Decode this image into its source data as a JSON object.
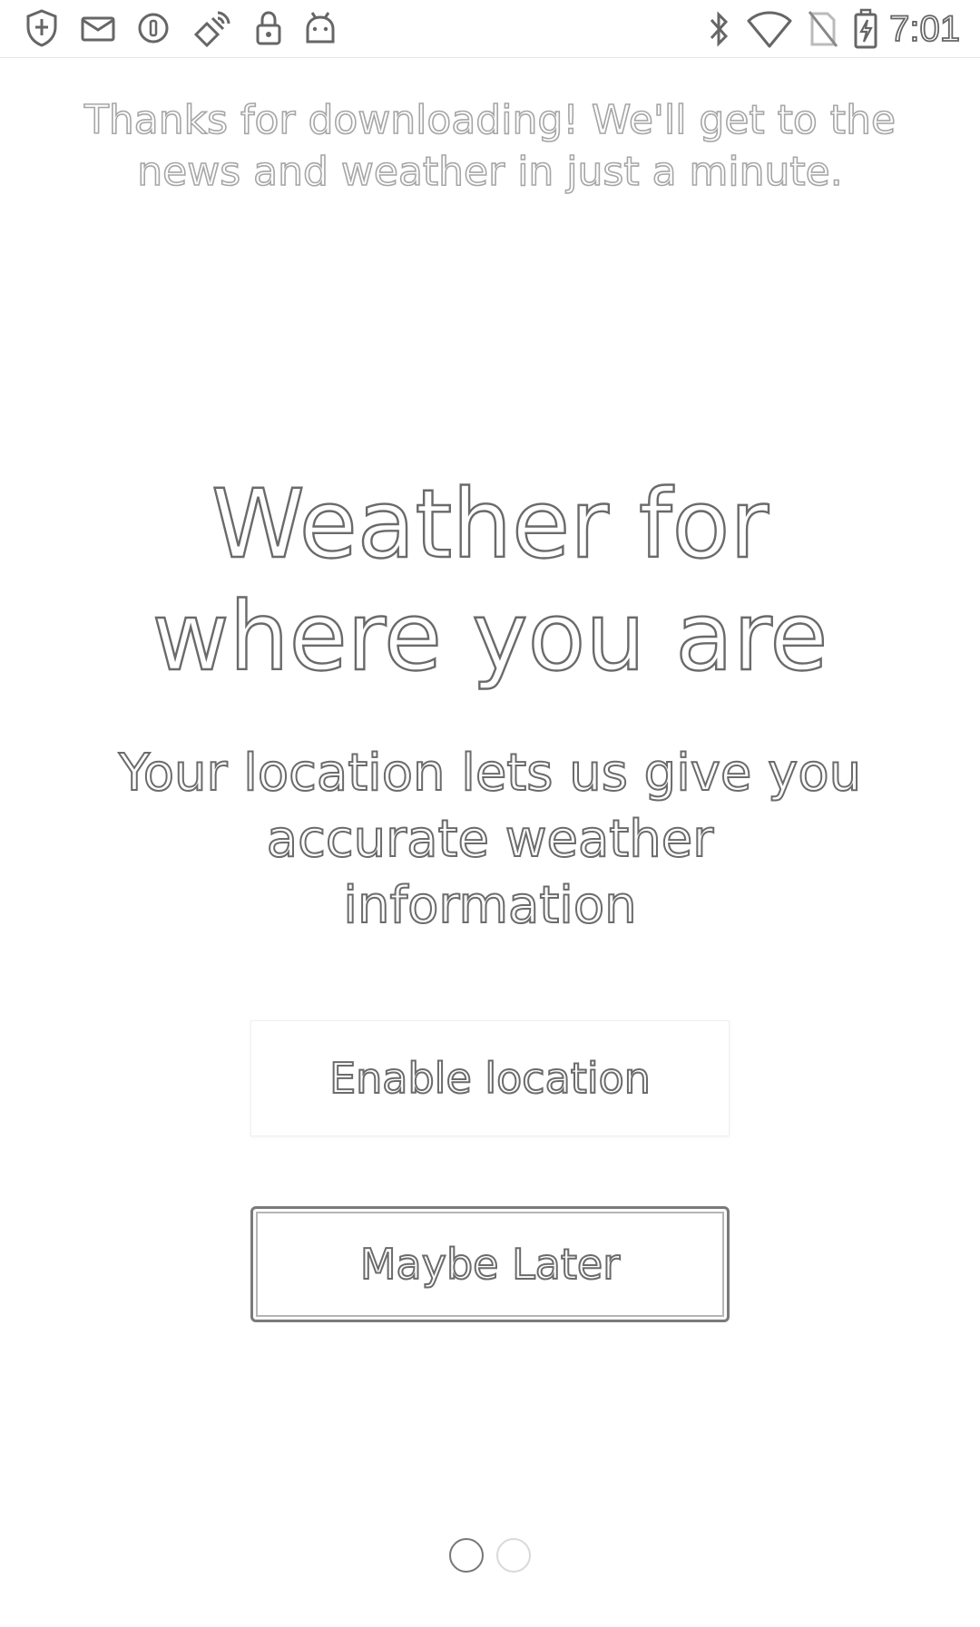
{
  "status_bar": {
    "time": "7:01",
    "left_icons": [
      "shield-icon",
      "mail-icon",
      "circle-icon",
      "satellite-icon",
      "lock-icon",
      "android-icon"
    ],
    "right_icons": [
      "bluetooth-icon",
      "wifi-icon",
      "no-sim-icon",
      "battery-charging-icon"
    ]
  },
  "onboarding": {
    "intro_text": "Thanks for downloading! We'll get to the news and weather in just a minute.",
    "headline": "Weather for where you are",
    "subtitle": "Your location lets us give you accurate weather information",
    "enable_button_label": "Enable location",
    "later_button_label": "Maybe Later"
  },
  "pager": {
    "total_pages": 2,
    "current_page": 1
  }
}
